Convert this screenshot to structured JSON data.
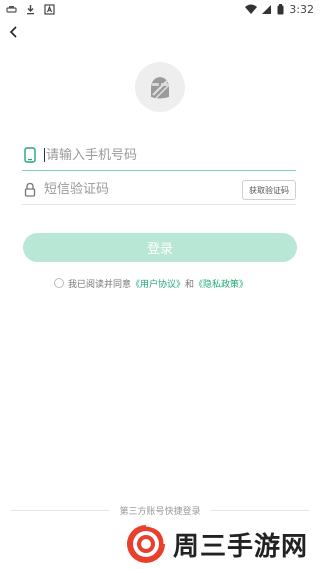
{
  "status_bar": {
    "time": "3:32"
  },
  "login": {
    "phone_placeholder": "请输入手机号码",
    "code_placeholder": "短信验证码",
    "get_code_label": "获取验证码",
    "login_button": "登录"
  },
  "agreement": {
    "prefix": "我已阅读并同意",
    "user_agreement": "《用户协议》",
    "and": "和",
    "privacy_policy": "《隐私政策》"
  },
  "third_party": {
    "label": "第三方账号快捷登录"
  },
  "watermark": {
    "text": "周三手游网"
  },
  "colors": {
    "accent": "#21a875",
    "button_bg": "#b8e7d6",
    "logo_red": "#e8402d"
  }
}
